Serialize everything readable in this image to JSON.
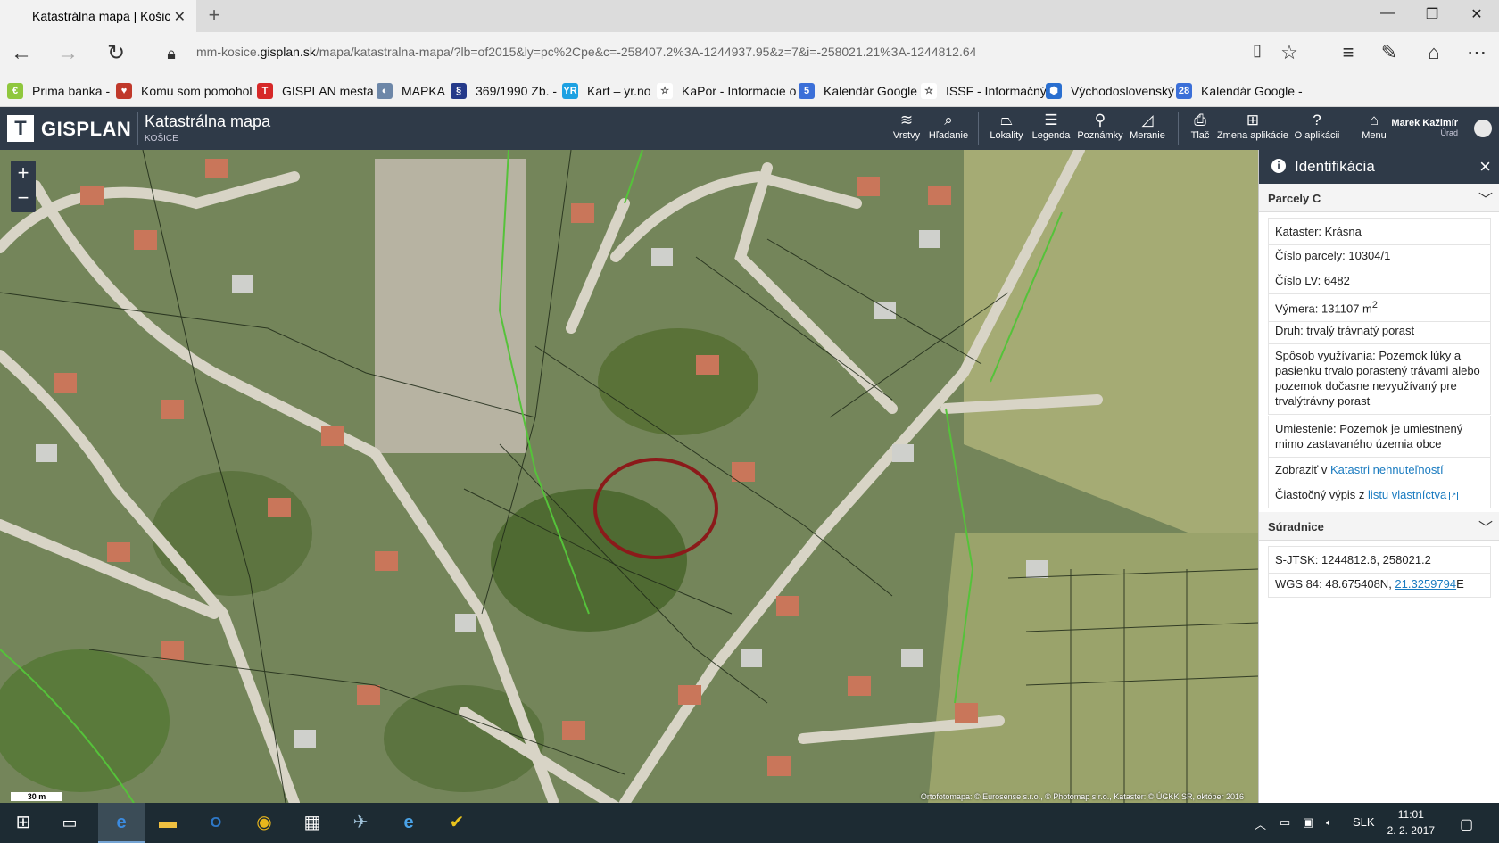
{
  "browser": {
    "tab_title": "Katastrálna mapa | Košic",
    "new_tab": "+",
    "url_prefix": "mm-kosice.",
    "url_host": "gisplan.sk",
    "url_path": "/mapa/katastralna-mapa/?lb=of2015&ly=pc%2Cpe&c=-258407.2%3A-1244937.95&z=7&i=-258021.21%3A-1244812.64"
  },
  "favorites": [
    {
      "label": "Prima banka -",
      "color": "#8fc73e",
      "glyph": "€"
    },
    {
      "label": "Komu som pomohol",
      "color": "#c0392b",
      "glyph": "♥"
    },
    {
      "label": "GISPLAN  mesta",
      "color": "#d62828",
      "glyph": "T"
    },
    {
      "label": "MAPKA",
      "color": "#6d87a8",
      "glyph": "◐"
    },
    {
      "label": "369/1990 Zb. -",
      "color": "#253a8a",
      "glyph": "§"
    },
    {
      "label": "Kart – yr.no",
      "color": "#1da1e2",
      "glyph": "YR"
    },
    {
      "label": "KaPor - Informácie o",
      "color": "#ffffff",
      "glyph": "☆"
    },
    {
      "label": "Kalendár Google",
      "color": "#3b6fd8",
      "glyph": "5"
    },
    {
      "label": "ISSF - Informačný",
      "color": "#ffffff",
      "glyph": "☆"
    },
    {
      "label": "Východoslovenský",
      "color": "#2a6fd0",
      "glyph": "⬢"
    },
    {
      "label": "Kalendár Google -",
      "color": "#3b6fd8",
      "glyph": "28"
    }
  ],
  "app": {
    "brand": "GISPLAN",
    "title": "Katastrálna mapa",
    "subtitle": "KOŠICE",
    "tools": [
      {
        "label": "Vrstvy",
        "icon": "≋"
      },
      {
        "label": "Hľadanie",
        "icon": "⌕"
      },
      {
        "label": "Lokality",
        "icon": "⏢"
      },
      {
        "label": "Legenda",
        "icon": "☰"
      },
      {
        "label": "Poznámky",
        "icon": "⚲"
      },
      {
        "label": "Meranie",
        "icon": "◿"
      },
      {
        "label": "Tlač",
        "icon": "⎙"
      },
      {
        "label": "Zmena aplikácie",
        "icon": "⊞"
      },
      {
        "label": "O aplikácii",
        "icon": "?"
      },
      {
        "label": "Menu",
        "icon": "⌂"
      }
    ],
    "user_name": "Marek Kažimír",
    "user_role": "Úrad"
  },
  "map": {
    "zoom_in": "+",
    "zoom_out": "−",
    "scale_label": "30 m",
    "attribution": "Ortofotomapa: © Eurosense s.r.o., © Photomap s.r.o., Kataster: © ÚGKK SR, október 2016"
  },
  "panel": {
    "title": "Identifikácia",
    "section_parcels": "Parcely C",
    "kataster": "Kataster: Krásna",
    "cislo_parcely": "Číslo parcely: 10304/1",
    "cislo_lv": "Číslo LV: 6482",
    "vymera": "Výmera: 131107 m",
    "vymera_sup": "2",
    "druh": "Druh: trvalý trávnatý porast",
    "sposob": "Spôsob využívania: Pozemok lúky a pasienku trvalo porastený trávami alebo pozemok dočasne nevyužívaný pre trvalýtrávny porast",
    "umiestnenie": "Umiestenie: Pozemok je umiestnený mimo zastavaného územia obce",
    "zobrazit_prefix": "Zobraziť v ",
    "zobrazit_link": "Katastri nehnuteľností",
    "vypis_prefix": "Čiastočný výpis z ",
    "vypis_link": "listu vlastníctva",
    "section_coords": "Súradnice",
    "sjtsk": "S-JTSK: 1244812.6, 258021.2",
    "wgs_prefix": "WGS 84: 48.675408N, ",
    "wgs_link": "21.3259794",
    "wgs_suffix": "E"
  },
  "taskbar": {
    "lang": "SLK",
    "time": "11:01",
    "date": "2. 2. 2017"
  }
}
